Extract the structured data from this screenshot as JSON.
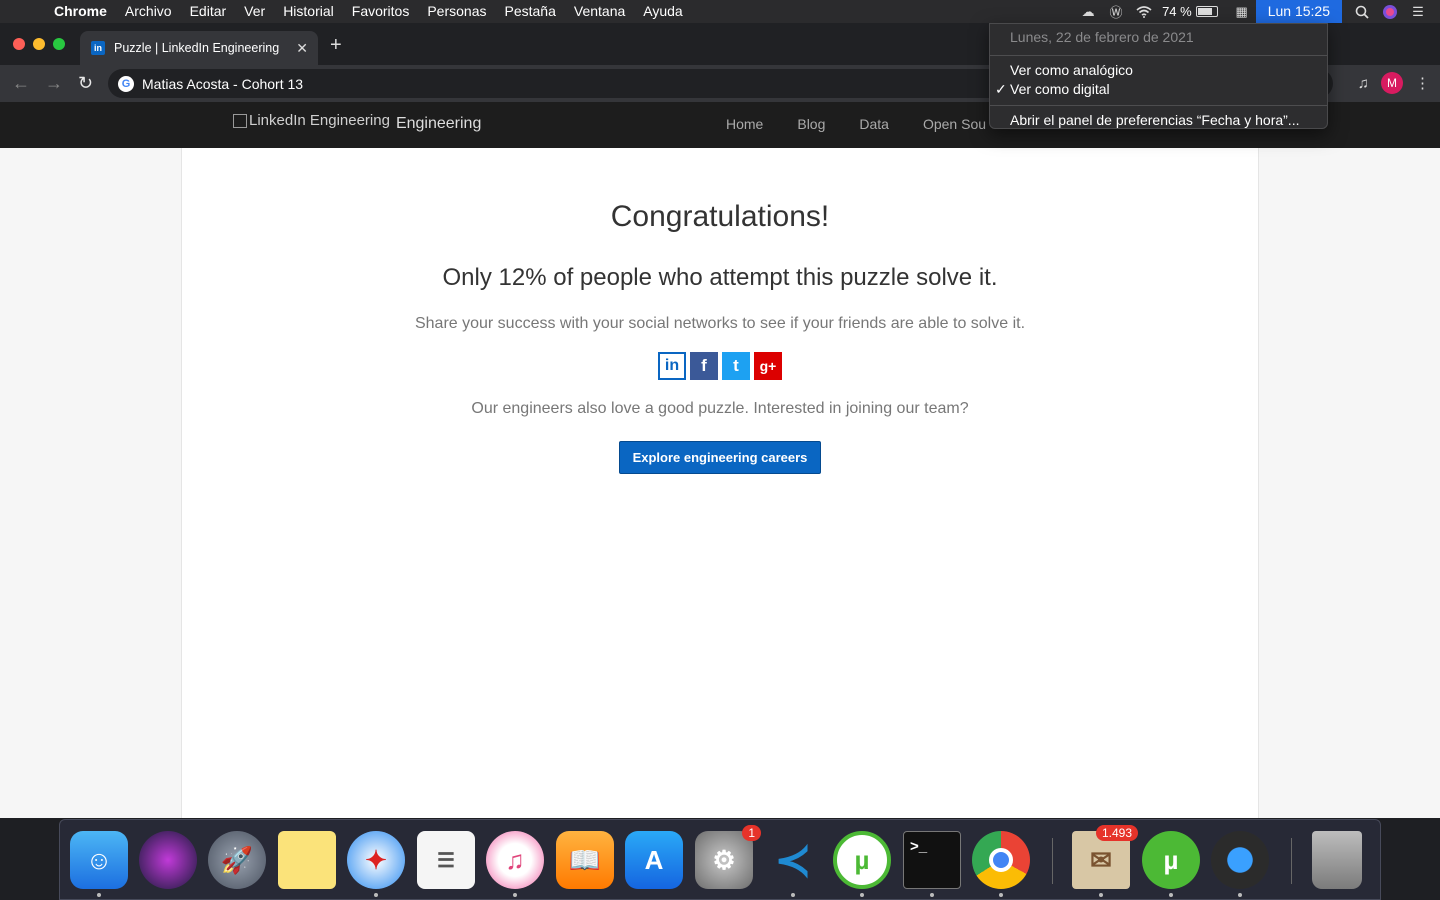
{
  "menubar": {
    "app_name": "Chrome",
    "menus": [
      "Archivo",
      "Editar",
      "Ver",
      "Historial",
      "Favoritos",
      "Personas",
      "Pestaña",
      "Ventana",
      "Ayuda"
    ],
    "battery": "74 %",
    "clock": "Lun 15:25"
  },
  "clock_menu": {
    "date": "Lunes, 22 de febrero de 2021",
    "items": [
      "Ver como analógico",
      "Ver como digital",
      "Abrir el panel de preferencias “Fecha y hora”..."
    ],
    "checked_item": "Ver como digital"
  },
  "browser": {
    "tab_title": "Puzzle | LinkedIn Engineering",
    "favicon_text": "in",
    "omnibox_text": "Matias Acosta - Cohort 13",
    "profile_initial": "M"
  },
  "site": {
    "logo_alt": "LinkedIn Engineering",
    "logo_suffix": "Engineering",
    "nav": [
      "Home",
      "Blog",
      "Data",
      "Open Sou"
    ]
  },
  "main": {
    "title": "Congratulations!",
    "stat": "Only 12% of people who attempt this puzzle solve it.",
    "share_text": "Share your success with your social networks to see if your friends are able to solve it.",
    "social": [
      "in",
      "f",
      "t",
      "g+"
    ],
    "team_text": "Our engineers also love a good puzzle. Interested in joining our team?",
    "cta_label": "Explore engineering careers"
  },
  "dock": {
    "badges": {
      "system_preferences": "1",
      "mail": "1.493"
    }
  },
  "colors": {
    "linkedin_blue": "#0a66c2",
    "menubar_highlight": "#1f6ae0",
    "chrome_dark": "#35363a"
  }
}
